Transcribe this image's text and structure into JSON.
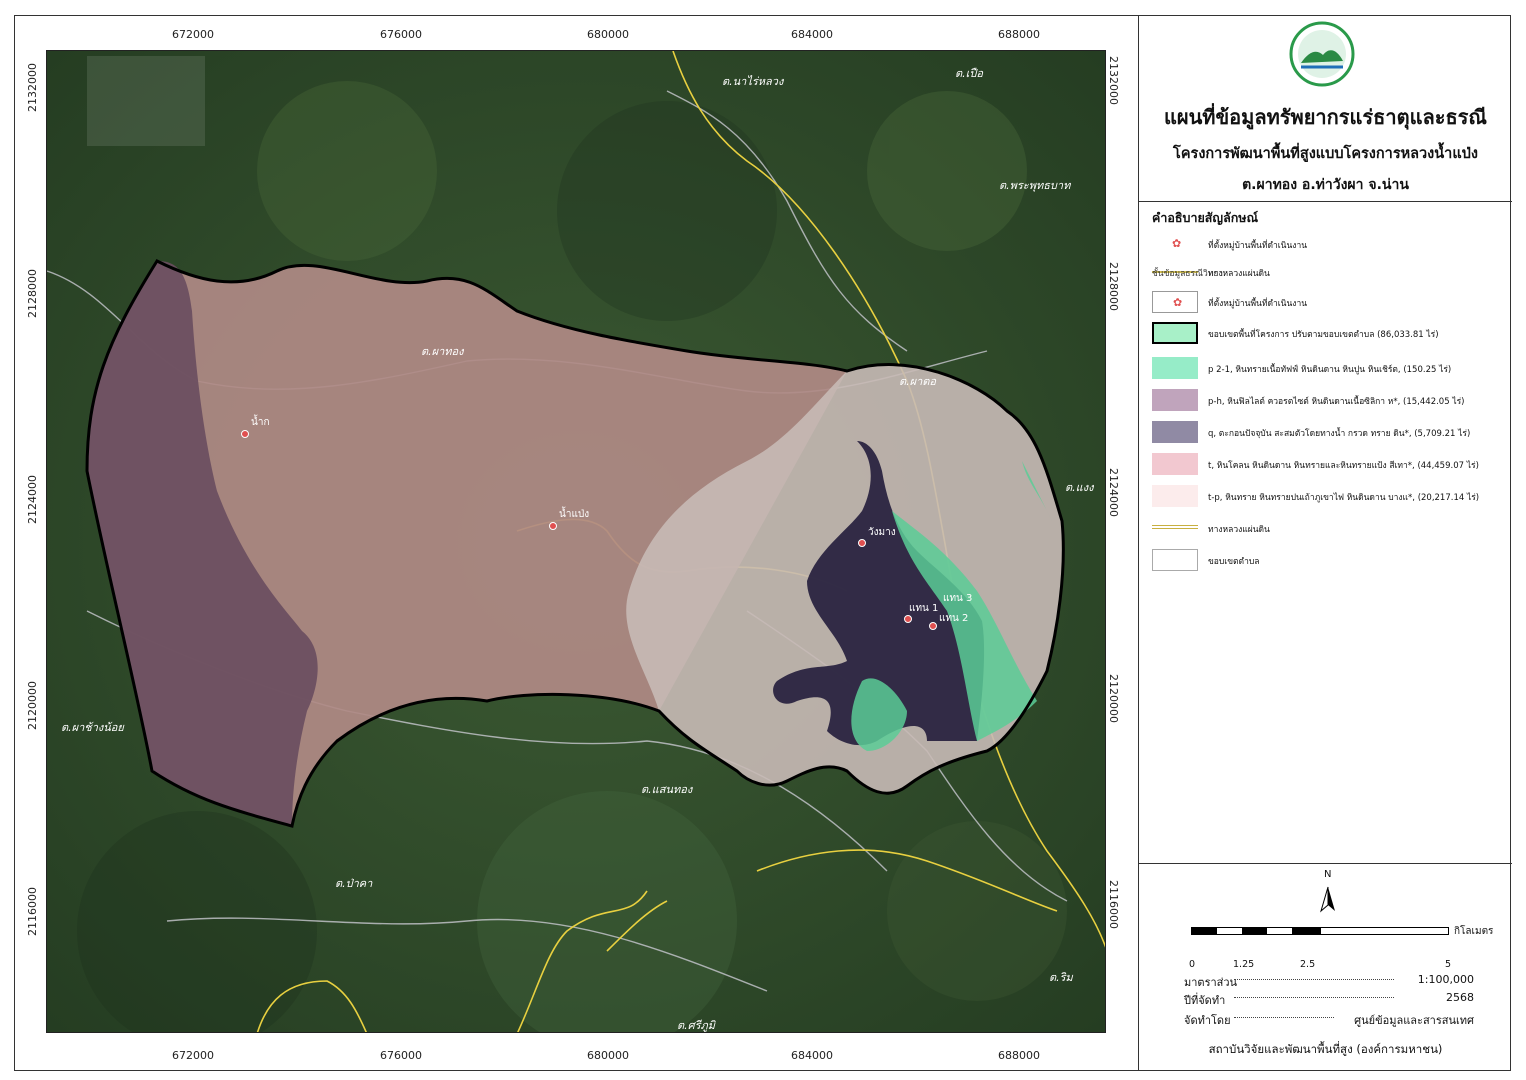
{
  "header": {
    "title": "แผนที่ข้อมูลทรัพยากรแร่ธาตุและธรณี",
    "project": "โครงการพัฒนาพื้นที่สูงแบบโครงการหลวงน้ำแป่ง",
    "location": "ต.ผาทอง อ.ท่าวังผา จ.น่าน"
  },
  "axes": {
    "x_ticks": [
      "672000",
      "676000",
      "680000",
      "684000",
      "688000"
    ],
    "y_ticks": [
      "2132000",
      "2128000",
      "2124000",
      "2120000",
      "2116000"
    ]
  },
  "map_labels": {
    "tambon": [
      "ต.นาไร่หลวง",
      "ต.เปือ",
      "ต.พระพุทธบาท",
      "ต.ผาทอง",
      "ต.ผาตอ",
      "ต.แงง",
      "ต.ผาช้างน้อย",
      "ต.แสนทอง",
      "ต.ป่าคา",
      "ต.ริม",
      "ต.ศรีภูมิ"
    ],
    "villages": [
      "น้ำก",
      "น้ำแป่ง",
      "วังมาง",
      "แทน 1",
      "แทน 2",
      "แทน 3"
    ]
  },
  "legend": {
    "title": "คำอธิบายสัญลักษณ์",
    "overlap_text_1": "ชั้นข้อมูลธรณีวิทยา",
    "overlap_text_2": "ที่ตั้งหมู่บ้านพื้นที่ดำเนินงาน",
    "overlap_text_3": "ขอบเขตพื้นที่โครงการ ปรับตามขอบเขตตำบล (86,033.81 ไร่)",
    "items": [
      {
        "label": "ที่ตั้งหมู่บ้านพื้นที่ดำเนินงาน",
        "kind": "point",
        "color": "#e05050"
      },
      {
        "label": "ทางหลวงแผ่นดิน",
        "kind": "line",
        "color": "#d4c050"
      },
      {
        "label": "ที่ตั้งหมู่บ้านพื้นที่ดำเนินงาน",
        "kind": "point-box",
        "color": "#e05050"
      },
      {
        "label": "ขอบเขตพื้นที่โครงการ",
        "kind": "boundary",
        "color": "#a8f0c8"
      },
      {
        "label": "p 2-1,  หินทรายเนื้อทัฟฟ์ หินดินดาน หินปูน หินเชิร์ต, (150.25 ไร่)",
        "kind": "fill",
        "color": "#96ecc8"
      },
      {
        "label": "p-h,  หินฟิลไลต์ ควอรตไซต์ หินดินดานเนื้อซิลิกา ห*, (15,442.05 ไร่)",
        "kind": "fill",
        "color": "#c0a4bc"
      },
      {
        "label": "q,  ตะกอนปัจจุบัน สะสมตัวโดยทางน้ำ กรวด  ทราย ดิน*, (5,709.21 ไร่)",
        "kind": "fill",
        "color": "#908aa4"
      },
      {
        "label": "t,  หินโคลน หินดินดาน หินทรายและหินทรายแป้ง สีเทา*, (44,459.07 ไร่)",
        "kind": "fill",
        "color": "#f2c8d0"
      },
      {
        "label": "t-p,  หินทราย หินทรายปนเถ้าภูเขาไฟ หินดินดาน บางแ*, (20,217.14 ไร่)",
        "kind": "fill",
        "color": "#fcecec"
      },
      {
        "label": "ทางหลวงแผ่นดิน",
        "kind": "line2",
        "color": "#c8b040"
      },
      {
        "label": "ขอบเขตตำบล",
        "kind": "box",
        "color": "#ffffff"
      }
    ]
  },
  "north_arrow": "N",
  "scale_bar": {
    "labels": [
      "0",
      "1.25",
      "2.5",
      "5"
    ],
    "unit": "กิโลเมตร"
  },
  "info": {
    "scale_key": "มาตราส่วน",
    "scale_value": "1:100,000",
    "year_key": "ปีที่จัดทำ",
    "year_value": "2568",
    "by_key": "จัดทำโดย",
    "by_value": "ศูนย์ข้อมูลและสารสนเทศ",
    "org": "สถาบันวิจัยและพัฒนาพื้นที่สูง (องค์การมหาชน)"
  },
  "colors": {
    "forest": "#2f4a2a",
    "t": "#b08a86",
    "p_h": "#6a4e60",
    "t_p": "#c8bab6",
    "q": "#2a2440",
    "p21": "#5acc96"
  }
}
